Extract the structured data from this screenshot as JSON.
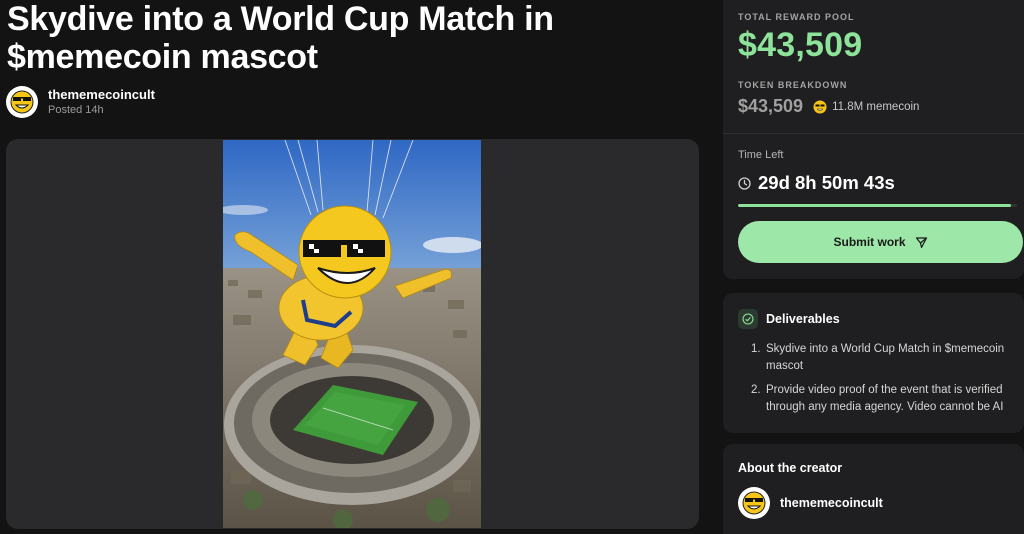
{
  "bounty": {
    "title": "Skydive into a World Cup Match in $memecoin mascot",
    "creator_name": "thememecoincult",
    "posted": "Posted 14h"
  },
  "reward": {
    "pool_label": "TOTAL REWARD POOL",
    "pool_amount": "$43,509",
    "breakdown_label": "TOKEN BREAKDOWN",
    "breakdown_usd": "$43,509",
    "breakdown_token": "11.8M memecoin",
    "accent_color": "#8ee39a"
  },
  "timer": {
    "label": "Time Left",
    "value": "29d 8h 50m 43s",
    "progress_fraction": 0.98
  },
  "submit": {
    "label": "Submit work",
    "icon": "send-icon"
  },
  "deliverables": {
    "title": "Deliverables",
    "items": [
      {
        "num": "1.",
        "text": "Skydive into a World Cup Match in $memecoin mascot"
      },
      {
        "num": "2.",
        "text": "Provide video proof of the event that is verified through any media agency. Video cannot be AI"
      }
    ]
  },
  "about": {
    "title": "About the creator",
    "creator_name": "thememecoincult"
  }
}
